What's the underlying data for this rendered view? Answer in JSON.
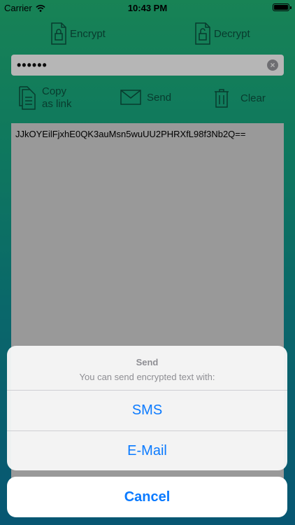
{
  "status_bar": {
    "carrier": "Carrier",
    "time": "10:43 PM",
    "wifi_icon": "wifi-icon",
    "battery_icon": "battery-icon"
  },
  "toolbar": {
    "encrypt_label": "Encrypt",
    "decrypt_label": "Decrypt",
    "encrypt_icon": "lock-document-icon",
    "decrypt_icon": "unlock-document-icon"
  },
  "password_field": {
    "value": "••••••",
    "clear_icon": "clear-icon"
  },
  "actions": {
    "copy_line1": "Copy",
    "copy_line2": "as link",
    "send_label": "Send",
    "clear_label": "Clear",
    "copy_icon": "copy-icon",
    "send_icon": "envelope-icon",
    "clear_icon": "trash-icon"
  },
  "output_text": "JJkOYEilFjxhE0QK3auMsn5wuUU2PHRXfL98f3Nb2Q==",
  "action_sheet": {
    "title": "Send",
    "message": "You can send encrypted text with:",
    "options": [
      "SMS",
      "E-Mail"
    ],
    "cancel_label": "Cancel"
  },
  "colors": {
    "gradient_top": "#1fa86e",
    "gradient_bottom": "#0a6f93",
    "accent": "#0a7aff",
    "toolbar_text": "#0b4c3b"
  }
}
